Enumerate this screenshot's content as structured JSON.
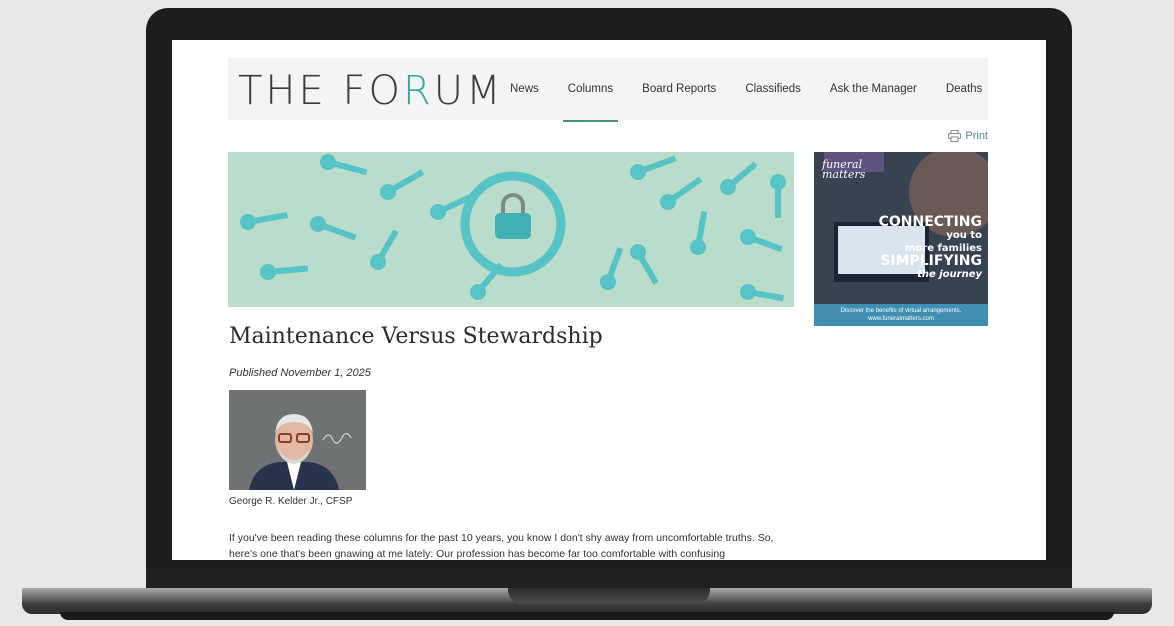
{
  "site": {
    "logo_prefix": "THE FO",
    "logo_accent": "R",
    "logo_suffix": "UM",
    "accent_color": "#3aa6a6"
  },
  "nav": {
    "items": [
      {
        "label": "News",
        "active": false
      },
      {
        "label": "Columns",
        "active": true
      },
      {
        "label": "Board Reports",
        "active": false
      },
      {
        "label": "Classifieds",
        "active": false
      },
      {
        "label": "Ask the Manager",
        "active": false
      },
      {
        "label": "Deaths",
        "active": false
      }
    ]
  },
  "toolbar": {
    "print_label": "Print",
    "print_icon": "printer-icon"
  },
  "ad": {
    "brand_line1": "funeral",
    "brand_line2": "matters",
    "headline_1": "CONNECTING",
    "headline_2": "you to",
    "headline_3": "more families",
    "headline_4": "SIMPLIFYING",
    "headline_5": "the journey",
    "footer_1": "Discover the benefits of virtual arrangements.",
    "footer_2": "www.funeralmatters.com"
  },
  "article": {
    "title": "Maintenance Versus Stewardship",
    "published": "Published November 1, 2025",
    "author": "George R. Kelder Jr., CFSP",
    "body": "If you've been reading these columns for the past 10 years, you know I don't shy away from uncomfortable truths. So, here's one that's been gnawing at me lately: Our profession has become far too comfortable with confusing"
  }
}
